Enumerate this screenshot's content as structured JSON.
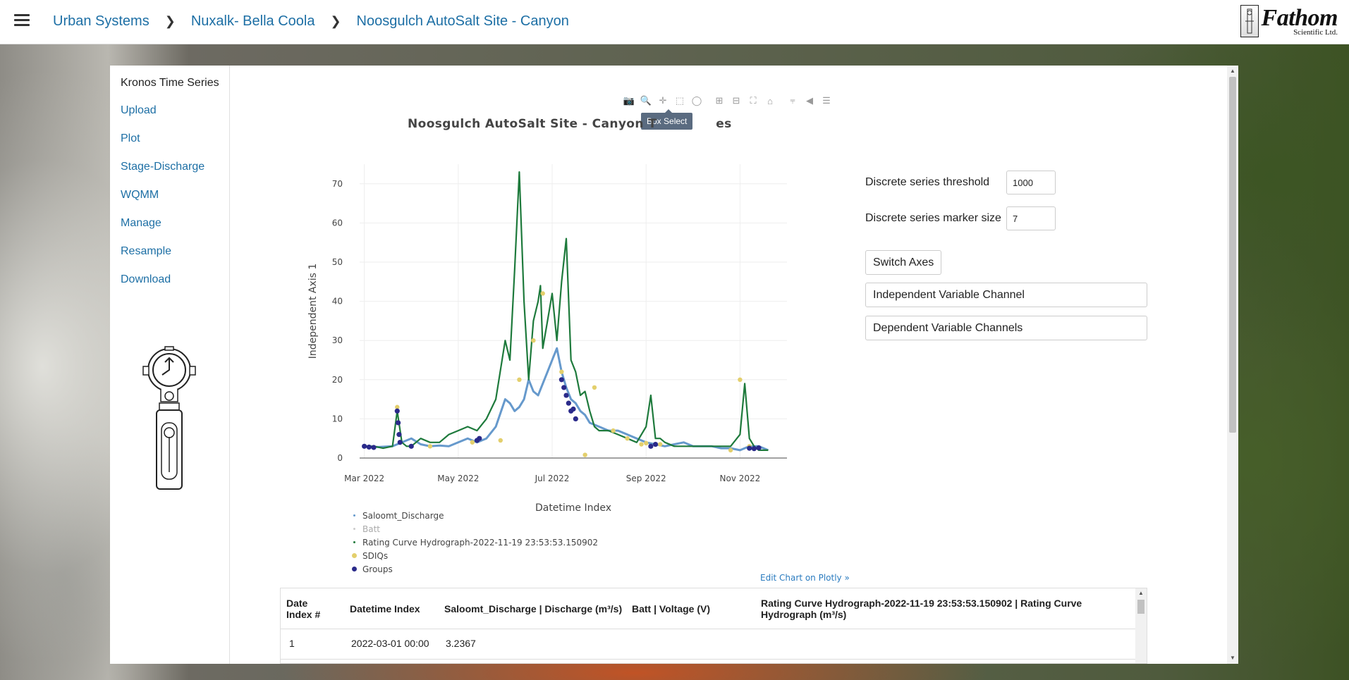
{
  "breadcrumb": [
    "Urban Systems",
    "Nuxalk- Bella Coola",
    "Noosgulch AutoSalt Site - Canyon"
  ],
  "logo": {
    "name": "Fathom",
    "sub": "Scientific Ltd."
  },
  "sidebar": {
    "title": "Kronos Time Series",
    "items": [
      "Upload",
      "Plot",
      "Stage-Discharge",
      "WQMM",
      "Manage",
      "Resample",
      "Download"
    ]
  },
  "toolbar": {
    "tooltip": "Box Select",
    "icons": [
      "camera-icon",
      "zoom-icon",
      "pan-icon",
      "box-select-icon",
      "lasso-icon",
      "zoom-in-icon",
      "zoom-out-icon",
      "autoscale-icon",
      "home-icon",
      "spike-lines-icon",
      "hover-closest-icon",
      "hover-compare-icon"
    ]
  },
  "controls": {
    "threshold_label": "Discrete series threshold",
    "threshold_value": "1000",
    "marker_label": "Discrete series marker size",
    "marker_value": "7",
    "switch_axes": "Switch Axes",
    "independent_channel": "Independent Variable Channel",
    "dependent_channels": "Dependent Variable Channels"
  },
  "edit_link": "Edit Chart on Plotly »",
  "table": {
    "headers": [
      "Date Index #",
      "Datetime Index",
      "Saloomt_Discharge | Discharge (m³/s)",
      "Batt | Voltage (V)",
      "Rating Curve Hydrograph-2022-11-19 23:53:53.150902 | Rating Curve Hydrograph (m³/s)"
    ],
    "rows": [
      [
        "1",
        "2022-03-01 00:00",
        "3.2367",
        "",
        ""
      ]
    ]
  },
  "chart_data": {
    "type": "line",
    "title": "Noosgulch AutoSalt Site - Canyon Time Series",
    "title_visible": "Noosgulch AutoSalt Site - Canyon T",
    "title_visible_end": "es",
    "xlabel": "Datetime Index",
    "ylabel": "Independent Axis 1",
    "ylim": [
      0,
      75
    ],
    "yticks": [
      0,
      10,
      20,
      30,
      40,
      50,
      60,
      70
    ],
    "xticks": [
      "Mar 2022",
      "May 2022",
      "Jul 2022",
      "Sep 2022",
      "Nov 2022"
    ],
    "xlim_months": [
      -0.1,
      9.0
    ],
    "xtick_months": [
      0,
      2,
      4,
      6,
      8
    ],
    "grid": true,
    "legend_position": "bottom-left",
    "series": [
      {
        "name": "Saloomt_Discharge",
        "color": "#6699cc",
        "x": [
          0,
          0.3,
          0.6,
          0.8,
          1.0,
          1.2,
          1.4,
          1.6,
          1.8,
          2.0,
          2.2,
          2.4,
          2.6,
          2.8,
          3.0,
          3.1,
          3.2,
          3.3,
          3.4,
          3.5,
          3.6,
          3.7,
          3.8,
          3.9,
          4.0,
          4.1,
          4.2,
          4.3,
          4.4,
          4.5,
          4.6,
          4.7,
          4.8,
          5.0,
          5.2,
          5.4,
          5.6,
          5.8,
          6.0,
          6.2,
          6.4,
          6.6,
          6.8,
          7.0,
          7.2,
          7.4,
          7.6,
          7.8,
          8.0,
          8.2,
          8.4,
          8.6
        ],
        "y": [
          3,
          2.8,
          3,
          4,
          5,
          3.5,
          3,
          3.2,
          3,
          4,
          5,
          4,
          5,
          8,
          15,
          14,
          12,
          13,
          15,
          20,
          17,
          16,
          19,
          22,
          25,
          28,
          22,
          18,
          15,
          14,
          12,
          11,
          9,
          8,
          7,
          7,
          6,
          5,
          4,
          3.5,
          3,
          3.5,
          4,
          3,
          3,
          3,
          2.5,
          2.5,
          2,
          3,
          3,
          2
        ]
      },
      {
        "name": "Batt",
        "color": "#cccccc",
        "x": [],
        "y": []
      },
      {
        "name": "Rating Curve Hydrograph-2022-11-19 23:53:53.150902",
        "color": "#1e7a3c",
        "x": [
          0,
          0.2,
          0.4,
          0.6,
          0.7,
          0.8,
          0.9,
          1.0,
          1.2,
          1.4,
          1.6,
          1.8,
          2.0,
          2.2,
          2.4,
          2.6,
          2.8,
          3.0,
          3.1,
          3.2,
          3.3,
          3.4,
          3.5,
          3.6,
          3.7,
          3.75,
          3.8,
          3.9,
          4.0,
          4.1,
          4.2,
          4.3,
          4.4,
          4.5,
          4.6,
          4.7,
          4.8,
          4.9,
          5.0,
          5.2,
          5.4,
          5.6,
          5.8,
          6.0,
          6.1,
          6.2,
          6.3,
          6.4,
          6.6,
          6.8,
          7.0,
          7.2,
          7.4,
          7.6,
          7.8,
          8.0,
          8.1,
          8.2,
          8.3,
          8.4,
          8.6
        ],
        "y": [
          3,
          3,
          2.5,
          3,
          12,
          4,
          3,
          3,
          5,
          4,
          4,
          6,
          7,
          8,
          7,
          10,
          15,
          30,
          25,
          48,
          73,
          40,
          20,
          35,
          40,
          44,
          28,
          35,
          42,
          30,
          45,
          56,
          25,
          22,
          16,
          17,
          12,
          8,
          7,
          7,
          6,
          5,
          4,
          8,
          16,
          5,
          5,
          4,
          3,
          3,
          3,
          3,
          3,
          3,
          3,
          6,
          19,
          5,
          3,
          2,
          2
        ]
      }
    ],
    "markers": [
      {
        "name": "SDIQs",
        "color": "#e3cf6c",
        "x": [
          0.7,
          1.4,
          2.3,
          2.9,
          3.3,
          3.6,
          3.8,
          4.2,
          4.7,
          4.9,
          5.3,
          5.6,
          5.9,
          6.0,
          6.3,
          7.8,
          8.0,
          8.2
        ],
        "y": [
          13,
          3,
          4,
          4.5,
          20,
          30,
          42,
          22,
          0.8,
          18,
          7,
          5,
          3.5,
          3.8,
          3.5,
          2,
          20,
          3
        ]
      },
      {
        "name": "Groups",
        "color": "#2a2a8a",
        "x": [
          0,
          0.1,
          0.2,
          0.7,
          0.72,
          0.74,
          0.76,
          1.0,
          2.4,
          2.45,
          4.2,
          4.25,
          4.3,
          4.35,
          4.4,
          4.45,
          4.5,
          6.1,
          6.2,
          8.2,
          8.3,
          8.4
        ],
        "y": [
          3,
          2.8,
          2.7,
          12,
          9,
          6,
          4,
          3,
          4.5,
          5,
          20,
          18,
          16,
          14,
          12,
          12.5,
          10,
          3,
          3.5,
          2.5,
          2.4,
          2.6
        ]
      }
    ]
  }
}
